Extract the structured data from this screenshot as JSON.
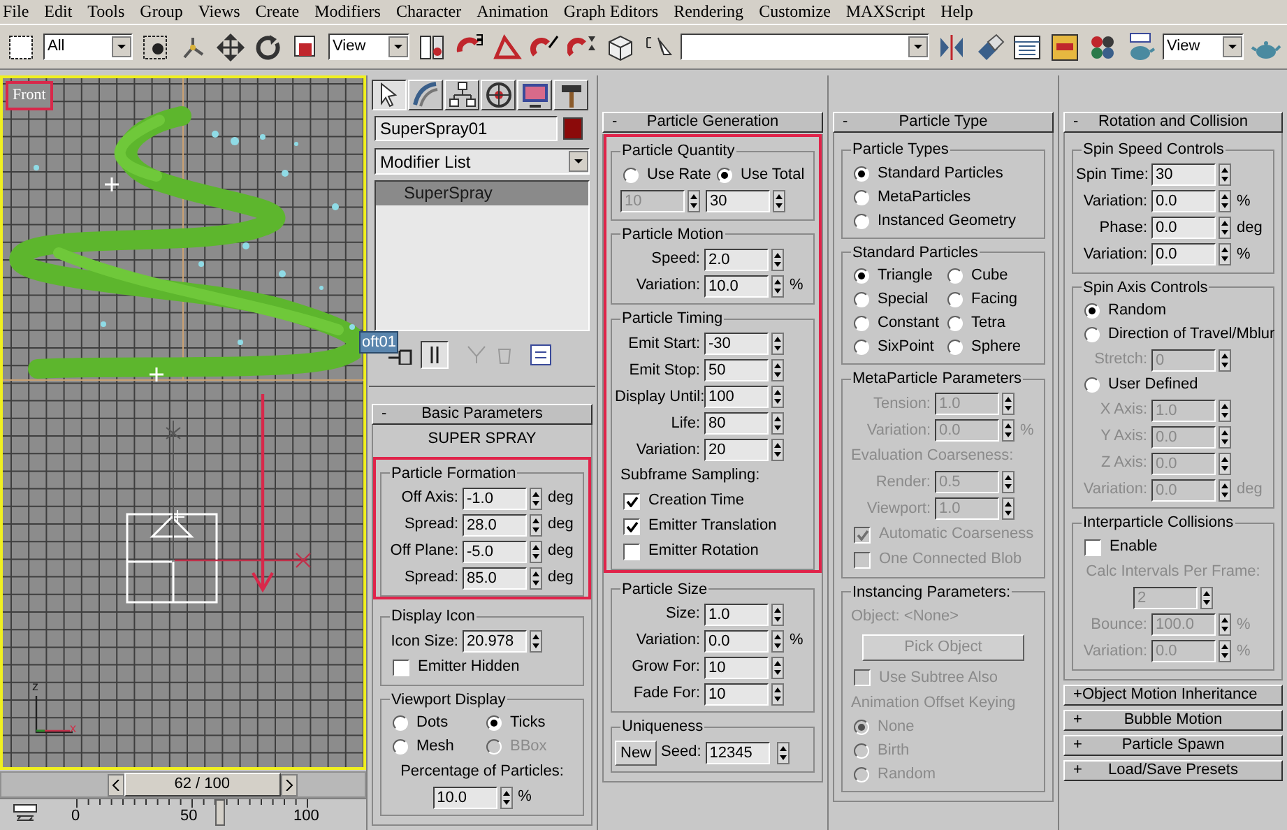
{
  "menu": [
    "File",
    "Edit",
    "Tools",
    "Group",
    "Views",
    "Create",
    "Modifiers",
    "Character",
    "Animation",
    "Graph Editors",
    "Rendering",
    "Customize",
    "MAXScript",
    "Help"
  ],
  "toolbar": {
    "selection_filter": "All",
    "reference_coordinate": "View",
    "render_view": "View"
  },
  "viewport": {
    "label": "Front",
    "label_highlighted": true,
    "active": true,
    "axis_labels": [
      "z",
      "x"
    ],
    "time_slider": {
      "text": "62 / 100",
      "level": 0.62
    },
    "track_bar": {
      "level": 0.62,
      "labels": [
        "0",
        "50",
        "100"
      ]
    }
  },
  "command_panel": {
    "tabs": [
      {
        "selected": true
      },
      {
        "selected": false
      },
      {
        "selected": false
      },
      {
        "selected": false
      },
      {
        "selected": false
      },
      {
        "selected": false
      }
    ],
    "object_name": "SuperSpray01",
    "modifier_list": "Modifier List",
    "stack": [
      {
        "label": "SuperSpray",
        "selected": true
      }
    ],
    "tooltip": "oft01"
  },
  "columns": [
    {
      "rollouts": [
        {
          "toggle": "-",
          "title": "Basic Parameters",
          "blocks": [
            {
              "highlighted": false,
              "items": [
                {
                  "kind": "caption",
                  "text": "SUPER SPRAY",
                  "disabled": false
                }
              ]
            },
            {
              "highlighted": true,
              "items": [
                {
                  "kind": "group",
                  "title": "Particle Formation",
                  "rows": [
                    {
                      "kind": "spinner",
                      "label": "Off Axis:",
                      "value": "-1.0",
                      "unit": "deg",
                      "disabled": false
                    },
                    {
                      "kind": "spinner",
                      "label": "Spread:",
                      "value": "28.0",
                      "unit": "deg",
                      "disabled": false
                    },
                    {
                      "kind": "spinner",
                      "label": "Off Plane:",
                      "value": "-5.0",
                      "unit": "deg",
                      "disabled": false
                    },
                    {
                      "kind": "spinner",
                      "label": "Spread:",
                      "value": "85.0",
                      "unit": "deg",
                      "disabled": false
                    }
                  ]
                }
              ]
            },
            {
              "highlighted": false,
              "items": [
                {
                  "kind": "group",
                  "title": "Display Icon",
                  "rows": [
                    {
                      "kind": "spinner",
                      "label": "Icon Size:",
                      "value": "20.978",
                      "disabled": false
                    },
                    {
                      "kind": "checkbox",
                      "label": "Emitter Hidden",
                      "checked": false,
                      "disabled": false
                    }
                  ]
                },
                {
                  "kind": "group",
                  "title": "Viewport Display",
                  "rows": [
                    {
                      "kind": "radio_grid",
                      "options": [
                        {
                          "label": "Dots",
                          "selected": false,
                          "disabled": false
                        },
                        {
                          "label": "Ticks",
                          "selected": true,
                          "disabled": false
                        },
                        {
                          "label": "Mesh",
                          "selected": false,
                          "disabled": false
                        },
                        {
                          "label": "BBox",
                          "selected": false,
                          "disabled": true
                        }
                      ]
                    },
                    {
                      "kind": "caption",
                      "text": "Percentage of Particles:",
                      "disabled": false
                    },
                    {
                      "kind": "spinner",
                      "value": "10.0",
                      "unit": "%",
                      "disabled": false
                    }
                  ]
                }
              ]
            }
          ]
        }
      ]
    },
    {
      "rollouts": [
        {
          "toggle": "-",
          "title": "Particle Generation",
          "blocks": [
            {
              "highlighted": true,
              "items": [
                {
                  "kind": "group",
                  "title": "Particle Quantity",
                  "rows": [
                    {
                      "kind": "radio_grid",
                      "options": [
                        {
                          "label": "Use Rate",
                          "selected": false,
                          "disabled": false
                        },
                        {
                          "label": "Use Total",
                          "selected": true,
                          "disabled": false
                        }
                      ]
                    },
                    {
                      "kind": "field_pair",
                      "fields": [
                        {
                          "value": "10",
                          "disabled": true
                        },
                        {
                          "value": "30",
                          "disabled": false
                        }
                      ]
                    }
                  ]
                },
                {
                  "kind": "group",
                  "title": "Particle Motion",
                  "rows": [
                    {
                      "kind": "spinner",
                      "label": "Speed:",
                      "value": "2.0",
                      "disabled": false
                    },
                    {
                      "kind": "spinner",
                      "label": "Variation:",
                      "value": "10.0",
                      "unit": "%",
                      "disabled": false
                    }
                  ]
                },
                {
                  "kind": "group",
                  "title": "Particle Timing",
                  "rows": [
                    {
                      "kind": "spinner",
                      "label": "Emit Start:",
                      "value": "-30",
                      "disabled": false
                    },
                    {
                      "kind": "spinner",
                      "label": "Emit Stop:",
                      "value": "50",
                      "disabled": false
                    },
                    {
                      "kind": "spinner",
                      "label": "Display Until:",
                      "value": "100",
                      "disabled": false
                    },
                    {
                      "kind": "spinner",
                      "label": "Life:",
                      "value": "80",
                      "disabled": false
                    },
                    {
                      "kind": "spinner",
                      "label": "Variation:",
                      "value": "20",
                      "disabled": false
                    },
                    {
                      "kind": "text",
                      "text": "Subframe Sampling:",
                      "disabled": false
                    },
                    {
                      "kind": "checkbox",
                      "label": "Creation Time",
                      "checked": true,
                      "disabled": false
                    },
                    {
                      "kind": "checkbox",
                      "label": "Emitter Translation",
                      "checked": true,
                      "disabled": false
                    },
                    {
                      "kind": "checkbox",
                      "label": "Emitter Rotation",
                      "checked": false,
                      "disabled": false
                    }
                  ]
                }
              ]
            },
            {
              "highlighted": false,
              "items": [
                {
                  "kind": "group",
                  "title": "Particle Size",
                  "rows": [
                    {
                      "kind": "spinner",
                      "label": "Size:",
                      "value": "1.0",
                      "disabled": false
                    },
                    {
                      "kind": "spinner",
                      "label": "Variation:",
                      "value": "0.0",
                      "unit": "%",
                      "disabled": false
                    },
                    {
                      "kind": "spinner",
                      "label": "Grow For:",
                      "value": "10",
                      "disabled": false
                    },
                    {
                      "kind": "spinner",
                      "label": "Fade For:",
                      "value": "10",
                      "disabled": false
                    }
                  ]
                },
                {
                  "kind": "group",
                  "title": "Uniqueness",
                  "rows": [
                    {
                      "kind": "button_spinner",
                      "button": "New",
                      "label": "Seed:",
                      "value": "12345",
                      "disabled": false
                    }
                  ]
                }
              ]
            }
          ]
        }
      ]
    },
    {
      "rollouts": [
        {
          "toggle": "-",
          "title": "Particle Type",
          "blocks": [
            {
              "highlighted": false,
              "items": [
                {
                  "kind": "group",
                  "title": "Particle Types",
                  "rows": [
                    {
                      "kind": "radio_list",
                      "options": [
                        {
                          "label": "Standard Particles",
                          "selected": true,
                          "disabled": false
                        },
                        {
                          "label": "MetaParticles",
                          "selected": false,
                          "disabled": false
                        },
                        {
                          "label": "Instanced Geometry",
                          "selected": false,
                          "disabled": false
                        }
                      ]
                    }
                  ]
                },
                {
                  "kind": "group",
                  "title": "Standard Particles",
                  "rows": [
                    {
                      "kind": "radio_grid",
                      "options": [
                        {
                          "label": "Triangle",
                          "selected": true,
                          "disabled": false
                        },
                        {
                          "label": "Cube",
                          "selected": false,
                          "disabled": false
                        },
                        {
                          "label": "Special",
                          "selected": false,
                          "disabled": false
                        },
                        {
                          "label": "Facing",
                          "selected": false,
                          "disabled": false
                        },
                        {
                          "label": "Constant",
                          "selected": false,
                          "disabled": false
                        },
                        {
                          "label": "Tetra",
                          "selected": false,
                          "disabled": false
                        },
                        {
                          "label": "SixPoint",
                          "selected": false,
                          "disabled": false
                        },
                        {
                          "label": "Sphere",
                          "selected": false,
                          "disabled": false
                        }
                      ]
                    }
                  ]
                },
                {
                  "kind": "group",
                  "title": "MetaParticle Parameters",
                  "rows": [
                    {
                      "kind": "spinner",
                      "label": "Tension:",
                      "value": "1.0",
                      "disabled": true
                    },
                    {
                      "kind": "spinner",
                      "label": "Variation:",
                      "value": "0.0",
                      "unit": "%",
                      "disabled": true
                    },
                    {
                      "kind": "text",
                      "text": "Evaluation Coarseness:",
                      "disabled": true
                    },
                    {
                      "kind": "spinner",
                      "label": "Render:",
                      "value": "0.5",
                      "disabled": true
                    },
                    {
                      "kind": "spinner",
                      "label": "Viewport:",
                      "value": "1.0",
                      "disabled": true
                    },
                    {
                      "kind": "checkbox",
                      "label": "Automatic Coarseness",
                      "checked": true,
                      "disabled": true
                    },
                    {
                      "kind": "checkbox",
                      "label": "One Connected Blob",
                      "checked": false,
                      "disabled": true
                    }
                  ]
                },
                {
                  "kind": "group",
                  "title": "Instancing Parameters:",
                  "rows": [
                    {
                      "kind": "text",
                      "text": "Object: <None>",
                      "disabled": true
                    },
                    {
                      "kind": "button",
                      "label": "Pick Object",
                      "disabled": true
                    },
                    {
                      "kind": "checkbox",
                      "label": "Use Subtree Also",
                      "checked": false,
                      "disabled": true
                    },
                    {
                      "kind": "text",
                      "text": "Animation Offset Keying",
                      "disabled": true
                    },
                    {
                      "kind": "radio_list",
                      "options": [
                        {
                          "label": "None",
                          "selected": true,
                          "disabled": true
                        },
                        {
                          "label": "Birth",
                          "selected": false,
                          "disabled": true
                        },
                        {
                          "label": "Random",
                          "selected": false,
                          "disabled": true
                        }
                      ]
                    }
                  ]
                }
              ]
            }
          ]
        }
      ]
    },
    {
      "rollouts": [
        {
          "toggle": "-",
          "title": "Rotation and Collision",
          "blocks": [
            {
              "highlighted": false,
              "items": [
                {
                  "kind": "group",
                  "title": "Spin Speed Controls",
                  "rows": [
                    {
                      "kind": "spinner",
                      "label": "Spin Time:",
                      "value": "30",
                      "disabled": false
                    },
                    {
                      "kind": "spinner",
                      "label": "Variation:",
                      "value": "0.0",
                      "unit": "%",
                      "disabled": false
                    },
                    {
                      "kind": "spinner",
                      "label": "Phase:",
                      "value": "0.0",
                      "unit": "deg",
                      "disabled": false
                    },
                    {
                      "kind": "spinner",
                      "label": "Variation:",
                      "value": "0.0",
                      "unit": "%",
                      "disabled": false
                    }
                  ]
                },
                {
                  "kind": "group",
                  "title": "Spin Axis Controls",
                  "rows": [
                    {
                      "kind": "radio_list",
                      "options": [
                        {
                          "label": "Random",
                          "selected": true,
                          "disabled": false
                        },
                        {
                          "label": "Direction of Travel/Mblur",
                          "selected": false,
                          "disabled": false
                        }
                      ]
                    },
                    {
                      "kind": "spinner",
                      "label": "Stretch:",
                      "value": "0",
                      "disabled": true
                    },
                    {
                      "kind": "radio_list",
                      "options": [
                        {
                          "label": "User Defined",
                          "selected": false,
                          "disabled": false
                        }
                      ]
                    },
                    {
                      "kind": "spinner",
                      "label": "X Axis:",
                      "value": "1.0",
                      "disabled": true
                    },
                    {
                      "kind": "spinner",
                      "label": "Y Axis:",
                      "value": "0.0",
                      "disabled": true
                    },
                    {
                      "kind": "spinner",
                      "label": "Z Axis:",
                      "value": "0.0",
                      "disabled": true
                    },
                    {
                      "kind": "spinner",
                      "label": "Variation:",
                      "value": "0.0",
                      "unit": "deg",
                      "disabled": true
                    }
                  ]
                },
                {
                  "kind": "group",
                  "title": "Interparticle Collisions",
                  "rows": [
                    {
                      "kind": "checkbox",
                      "label": "Enable",
                      "checked": false,
                      "disabled": false
                    },
                    {
                      "kind": "caption",
                      "text": "Calc Intervals Per Frame:",
                      "disabled": true
                    },
                    {
                      "kind": "spinner",
                      "value": "2",
                      "disabled": true
                    },
                    {
                      "kind": "spinner",
                      "label": "Bounce:",
                      "value": "100.0",
                      "unit": "%",
                      "disabled": true
                    },
                    {
                      "kind": "spinner",
                      "label": "Variation:",
                      "value": "0.0",
                      "unit": "%",
                      "disabled": true
                    }
                  ]
                }
              ]
            }
          ]
        },
        {
          "toggle": "+",
          "title": "Object Motion Inheritance"
        },
        {
          "toggle": "+",
          "title": "Bubble Motion"
        },
        {
          "toggle": "+",
          "title": "Particle Spawn"
        },
        {
          "toggle": "+",
          "title": "Load/Save Presets"
        }
      ]
    }
  ]
}
